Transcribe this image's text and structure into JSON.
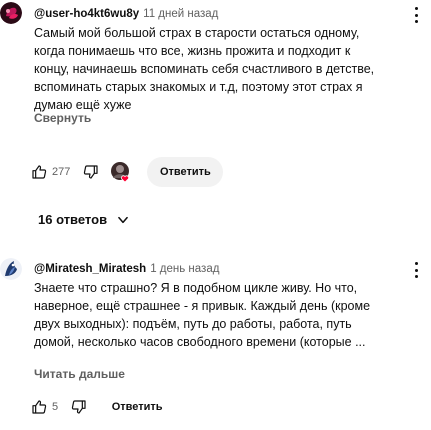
{
  "comments": [
    {
      "author": "@user-ho4kt6wu8y",
      "time": "11 дней назад",
      "lines": [
        "Самый мой большой страх в старости остаться одному,",
        "когда понимаешь что все, жизнь прожита и подходит к",
        "концу, начинаешь вспоминать себя счастливого в детстве,",
        "вспоминать старых знакомых и т.д, поэтому этот страх я",
        "думаю ещё хуже"
      ],
      "toggle_label": "Свернуть",
      "likes": "277",
      "reply_label": "Ответить"
    },
    {
      "author": "@Miratesh_Miratesh",
      "time": "1 день назад",
      "lines": [
        "Знаете что страшно? Я в подобном цикле живу. Но что,",
        "наверное, ещё страшнее - я привык. Каждый день (кроме",
        "двух выходных): подъём, путь до работы, работа, путь",
        "домой, несколько часов свободного времени (которые ..."
      ],
      "toggle_label": "Читать дальше",
      "likes": "5",
      "reply_label": "Ответить"
    }
  ],
  "replies_label": "16 ответов",
  "colors": {
    "text": "#0f0f0f",
    "muted": "#606060",
    "reply_button_bg": "#f2f2f2",
    "heart_red": "#ff0033"
  },
  "icons": [
    "avatar-user",
    "avatar-miratesh",
    "kebab-menu-icon",
    "thumbs-up-icon",
    "thumbs-down-icon",
    "creator-heart-icon",
    "chevron-down-icon"
  ]
}
